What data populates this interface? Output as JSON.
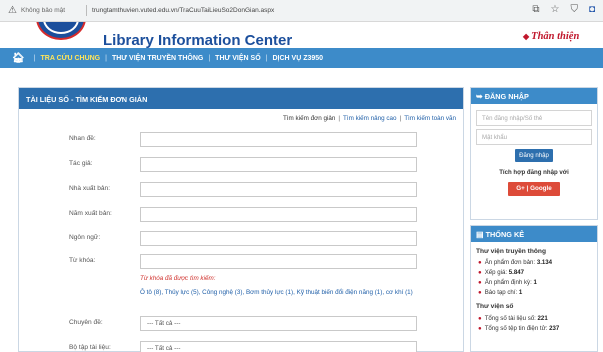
{
  "browser": {
    "security_icon": "warning-triangle-icon",
    "security_text": "Không bảo mật",
    "url": "trungtamthuvien.vuted.edu.vn/TraCuuTaiLieuSo2DonGian.aspx",
    "toolbar_icons": [
      "share-icon",
      "star-icon",
      "shield-icon",
      "extension-icon"
    ]
  },
  "header": {
    "site_title": "Library Information Center",
    "slogan": "Thân thiện",
    "colors": {
      "primary": "#1c4f9c",
      "nav": "#3d8bc9",
      "accent": "#c0172c",
      "active_nav": "#ffe55a"
    }
  },
  "nav": {
    "home_icon": "home-icon",
    "items": [
      {
        "label": "TRA CỨU CHUNG",
        "active": true
      },
      {
        "label": "THƯ VIỆN TRUYỀN THÔNG",
        "active": false
      },
      {
        "label": "THƯ VIỆN SỐ",
        "active": false
      },
      {
        "label": "DỊCH VỤ Z3950",
        "active": false
      }
    ]
  },
  "search": {
    "panel_title": "TÀI LIỆU SỐ - TÌM KIẾM ĐƠN GIẢN",
    "mode_links": [
      "Tìm kiếm đơn giản",
      "Tìm kiếm nâng cao",
      "Tìm kiếm toàn văn"
    ],
    "fields": [
      {
        "label": "Nhan đề:",
        "value": ""
      },
      {
        "label": "Tác giả:",
        "value": ""
      },
      {
        "label": "Nhà xuất bản:",
        "value": ""
      },
      {
        "label": "Năm xuất bản:",
        "value": ""
      },
      {
        "label": "Ngôn ngữ:",
        "value": ""
      },
      {
        "label": "Từ khóa:",
        "value": ""
      }
    ],
    "keyword_note": "Từ khóa đã được tìm kiếm:",
    "keyword_list": "Ô tô (8), Thủy lực (5), Công nghệ (3), Bơm thủy lực (1), Kỹ thuật biến đổi điện năng (1), cơ khí (1)",
    "selects": [
      {
        "label": "Chuyên đề:",
        "value": "--- Tất cả ---"
      },
      {
        "label": "Bộ tập tài liệu:",
        "value": "--- Tất cả ---"
      }
    ]
  },
  "login": {
    "title": "ĐĂNG NHẬP",
    "icon": "login-icon",
    "username_placeholder": "Tên đăng nhập/Số thẻ",
    "password_placeholder": "Mật khẩu",
    "button": "Đăng nhập",
    "login_with": "Tích hợp đăng nhập với",
    "google_button": "G+ | Google"
  },
  "stats": {
    "title": "THỐNG KÊ",
    "icon": "stats-icon",
    "sections": [
      {
        "title": "Thư viện truyền thông",
        "rows": [
          {
            "label": "Ấn phẩm đơn bản:",
            "value": "3.134"
          },
          {
            "label": "Xếp giá:",
            "value": "5.847"
          },
          {
            "label": "Ấn phẩm định kỳ:",
            "value": "1"
          },
          {
            "label": "Báo tạp chí:",
            "value": "1"
          }
        ]
      },
      {
        "title": "Thư viện số",
        "rows": [
          {
            "label": "Tổng số tài liệu số:",
            "value": "221"
          },
          {
            "label": "Tổng số tệp tin điện tử:",
            "value": "237"
          }
        ]
      }
    ]
  }
}
